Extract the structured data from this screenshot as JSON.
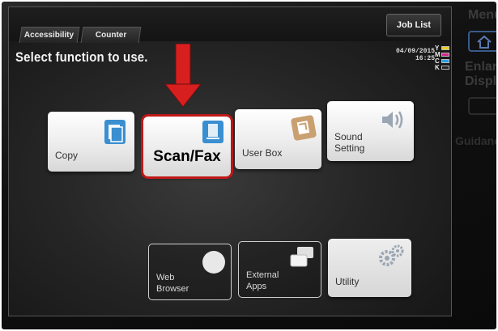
{
  "tabs": [
    {
      "label": "Accessibility"
    },
    {
      "label": "Counter"
    }
  ],
  "instruction": "Select function to use.",
  "job_list_label": "Job List",
  "datetime": {
    "date": "04/09/2015",
    "time": "16:25"
  },
  "toner": [
    {
      "letter": "Y",
      "color": "#e8d020"
    },
    {
      "letter": "M",
      "color": "#d02a8a"
    },
    {
      "letter": "C",
      "color": "#28a0e0"
    },
    {
      "letter": "K",
      "color": "#222222"
    }
  ],
  "tiles": {
    "copy": "Copy",
    "scan_fax": "Scan/Fax",
    "user_box": "User Box",
    "sound_setting_1": "Sound",
    "sound_setting_2": "Setting",
    "web_browser_1": "Web",
    "web_browser_2": "Browser",
    "external_apps_1": "External",
    "external_apps_2": "Apps",
    "utility": "Utility"
  },
  "side_panel": {
    "line1": "Menu",
    "line2": "Enlarge",
    "line3": "Display",
    "line4": "Guidance"
  },
  "colors": {
    "highlight": "#c01818",
    "arrow": "#d81f1f",
    "accent_blue": "#3a8fd0",
    "accent_tan": "#c9a070"
  }
}
